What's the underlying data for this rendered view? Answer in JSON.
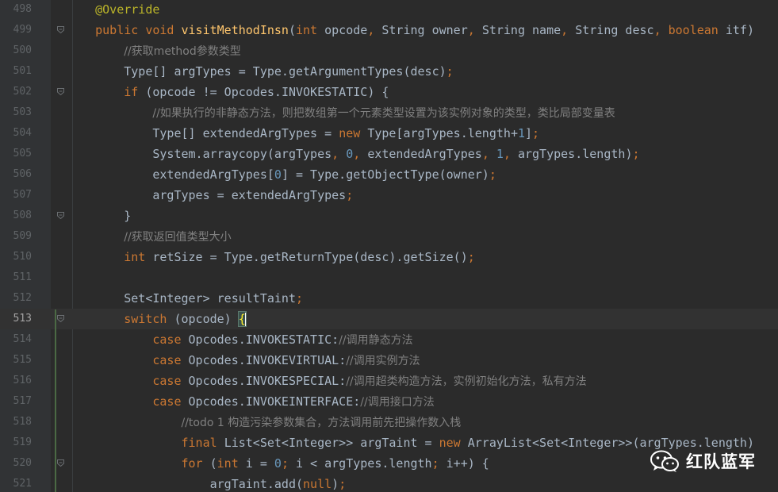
{
  "editor": {
    "lines": [
      {
        "no": "498",
        "fold": false,
        "indent": 1,
        "tokens": [
          {
            "t": "@Override",
            "c": "ann"
          }
        ]
      },
      {
        "no": "499",
        "fold": true,
        "indent": 1,
        "tokens": [
          {
            "t": "public ",
            "c": "kw"
          },
          {
            "t": "void ",
            "c": "kw"
          },
          {
            "t": "visitMethodInsn",
            "c": "fn"
          },
          {
            "t": "(",
            "c": "tx"
          },
          {
            "t": "int ",
            "c": "kw"
          },
          {
            "t": "opcode",
            "c": "tx"
          },
          {
            "t": ", ",
            "c": "kw"
          },
          {
            "t": "String owner",
            "c": "tx"
          },
          {
            "t": ", ",
            "c": "kw"
          },
          {
            "t": "String name",
            "c": "tx"
          },
          {
            "t": ", ",
            "c": "kw"
          },
          {
            "t": "String desc",
            "c": "tx"
          },
          {
            "t": ", ",
            "c": "kw"
          },
          {
            "t": "boolean ",
            "c": "kw"
          },
          {
            "t": "itf)",
            "c": "tx"
          }
        ]
      },
      {
        "no": "500",
        "fold": false,
        "indent": 2,
        "tokens": [
          {
            "t": "//获取method参数类型",
            "c": "cm"
          }
        ]
      },
      {
        "no": "501",
        "fold": false,
        "indent": 2,
        "tokens": [
          {
            "t": "Type[] argTypes = Type.",
            "c": "tx"
          },
          {
            "t": "getArgumentTypes",
            "c": "tx"
          },
          {
            "t": "(desc)",
            "c": "tx"
          },
          {
            "t": ";",
            "c": "kw"
          }
        ]
      },
      {
        "no": "502",
        "fold": true,
        "indent": 2,
        "tokens": [
          {
            "t": "if ",
            "c": "kw"
          },
          {
            "t": "(opcode != Opcodes.",
            "c": "tx"
          },
          {
            "t": "INVOKESTATIC",
            "c": "tx"
          },
          {
            "t": ") {",
            "c": "tx"
          }
        ]
      },
      {
        "no": "503",
        "fold": false,
        "indent": 3,
        "tokens": [
          {
            "t": "//如果执行的非静态方法，则把数组第一个元素类型设置为该实例对象的类型，类比局部变量表",
            "c": "cm"
          }
        ]
      },
      {
        "no": "504",
        "fold": false,
        "indent": 3,
        "tokens": [
          {
            "t": "Type[] extendedArgTypes = ",
            "c": "tx"
          },
          {
            "t": "new ",
            "c": "kw"
          },
          {
            "t": "Type[argTypes.",
            "c": "tx"
          },
          {
            "t": "length",
            "c": "tx"
          },
          {
            "t": "+",
            "c": "tx"
          },
          {
            "t": "1",
            "c": "num"
          },
          {
            "t": "]",
            "c": "tx"
          },
          {
            "t": ";",
            "c": "kw"
          }
        ]
      },
      {
        "no": "505",
        "fold": false,
        "indent": 3,
        "tokens": [
          {
            "t": "System.",
            "c": "tx"
          },
          {
            "t": "arraycopy",
            "c": "tx"
          },
          {
            "t": "(argTypes",
            "c": "tx"
          },
          {
            "t": ", ",
            "c": "kw"
          },
          {
            "t": "0",
            "c": "num"
          },
          {
            "t": ", ",
            "c": "kw"
          },
          {
            "t": "extendedArgTypes",
            "c": "tx"
          },
          {
            "t": ", ",
            "c": "kw"
          },
          {
            "t": "1",
            "c": "num"
          },
          {
            "t": ", ",
            "c": "kw"
          },
          {
            "t": "argTypes.",
            "c": "tx"
          },
          {
            "t": "length",
            "c": "tx"
          },
          {
            "t": ")",
            "c": "tx"
          },
          {
            "t": ";",
            "c": "kw"
          }
        ]
      },
      {
        "no": "506",
        "fold": false,
        "indent": 3,
        "tokens": [
          {
            "t": "extendedArgTypes[",
            "c": "tx"
          },
          {
            "t": "0",
            "c": "num"
          },
          {
            "t": "] = Type.",
            "c": "tx"
          },
          {
            "t": "getObjectType",
            "c": "tx"
          },
          {
            "t": "(owner)",
            "c": "tx"
          },
          {
            "t": ";",
            "c": "kw"
          }
        ]
      },
      {
        "no": "507",
        "fold": false,
        "indent": 3,
        "tokens": [
          {
            "t": "argTypes = extendedArgTypes",
            "c": "tx"
          },
          {
            "t": ";",
            "c": "kw"
          }
        ]
      },
      {
        "no": "508",
        "fold": true,
        "indent": 2,
        "tokens": [
          {
            "t": "}",
            "c": "tx"
          }
        ]
      },
      {
        "no": "509",
        "fold": false,
        "indent": 2,
        "tokens": [
          {
            "t": "//获取返回值类型大小",
            "c": "cm"
          }
        ]
      },
      {
        "no": "510",
        "fold": false,
        "indent": 2,
        "tokens": [
          {
            "t": "int ",
            "c": "kw"
          },
          {
            "t": "retSize = Type.",
            "c": "tx"
          },
          {
            "t": "getReturnType",
            "c": "tx"
          },
          {
            "t": "(desc).getSize()",
            "c": "tx"
          },
          {
            "t": ";",
            "c": "kw"
          }
        ]
      },
      {
        "no": "511",
        "fold": false,
        "indent": 0,
        "tokens": []
      },
      {
        "no": "512",
        "fold": false,
        "indent": 2,
        "tokens": [
          {
            "t": "Set<Integer> resultTaint",
            "c": "tx"
          },
          {
            "t": ";",
            "c": "kw"
          }
        ]
      },
      {
        "no": "513",
        "fold": true,
        "indent": 2,
        "current": true,
        "tokens": [
          {
            "t": "switch ",
            "c": "kw"
          },
          {
            "t": "(opcode) ",
            "c": "tx"
          },
          {
            "t": "{",
            "c": "brace"
          }
        ]
      },
      {
        "no": "514",
        "fold": false,
        "indent": 3,
        "tokens": [
          {
            "t": "case ",
            "c": "kw"
          },
          {
            "t": "Opcodes.",
            "c": "tx"
          },
          {
            "t": "INVOKESTATIC",
            "c": "tx"
          },
          {
            "t": ":",
            "c": "tx"
          },
          {
            "t": "//调用静态方法",
            "c": "cm"
          }
        ]
      },
      {
        "no": "515",
        "fold": false,
        "indent": 3,
        "tokens": [
          {
            "t": "case ",
            "c": "kw"
          },
          {
            "t": "Opcodes.",
            "c": "tx"
          },
          {
            "t": "INVOKEVIRTUAL",
            "c": "tx"
          },
          {
            "t": ":",
            "c": "tx"
          },
          {
            "t": "//调用实例方法",
            "c": "cm"
          }
        ]
      },
      {
        "no": "516",
        "fold": false,
        "indent": 3,
        "tokens": [
          {
            "t": "case ",
            "c": "kw"
          },
          {
            "t": "Opcodes.",
            "c": "tx"
          },
          {
            "t": "INVOKESPECIAL",
            "c": "tx"
          },
          {
            "t": ":",
            "c": "tx"
          },
          {
            "t": "//调用超类构造方法，实例初始化方法，私有方法",
            "c": "cm"
          }
        ]
      },
      {
        "no": "517",
        "fold": false,
        "indent": 3,
        "tokens": [
          {
            "t": "case ",
            "c": "kw"
          },
          {
            "t": "Opcodes.",
            "c": "tx"
          },
          {
            "t": "INVOKEINTERFACE",
            "c": "tx"
          },
          {
            "t": ":",
            "c": "tx"
          },
          {
            "t": "//调用接口方法",
            "c": "cm"
          }
        ]
      },
      {
        "no": "518",
        "fold": false,
        "indent": 4,
        "tokens": [
          {
            "t": "//todo 1 构造污染参数集合，方法调用前先把操作数入栈",
            "c": "cm"
          }
        ]
      },
      {
        "no": "519",
        "fold": false,
        "indent": 4,
        "tokens": [
          {
            "t": "final ",
            "c": "kw"
          },
          {
            "t": "List<Set<Integer>> argTaint = ",
            "c": "tx"
          },
          {
            "t": "new ",
            "c": "kw"
          },
          {
            "t": "ArrayList<Set<Integer>>(argTypes.",
            "c": "tx"
          },
          {
            "t": "length",
            "c": "tx"
          },
          {
            "t": ")",
            "c": "tx"
          }
        ]
      },
      {
        "no": "520",
        "fold": true,
        "indent": 4,
        "tokens": [
          {
            "t": "for ",
            "c": "kw"
          },
          {
            "t": "(",
            "c": "tx"
          },
          {
            "t": "int ",
            "c": "kw"
          },
          {
            "t": "i = ",
            "c": "tx"
          },
          {
            "t": "0",
            "c": "num"
          },
          {
            "t": "; ",
            "c": "kw"
          },
          {
            "t": "i < argTypes.",
            "c": "tx"
          },
          {
            "t": "length",
            "c": "tx"
          },
          {
            "t": "; ",
            "c": "kw"
          },
          {
            "t": "i++) {",
            "c": "tx"
          }
        ]
      },
      {
        "no": "521",
        "fold": false,
        "indent": 5,
        "tokens": [
          {
            "t": "argTaint.add(",
            "c": "tx"
          },
          {
            "t": "null",
            "c": "kw"
          },
          {
            "t": ")",
            "c": "tx"
          },
          {
            "t": ";",
            "c": "kw"
          }
        ]
      }
    ]
  },
  "watermark": {
    "icon": "wechat-icon",
    "text": "红队蓝军"
  },
  "colors": {
    "background": "#2b2b2b",
    "gutter": "#313335",
    "keyword": "#cc7832",
    "annotation": "#bbb529",
    "function": "#ffc66d",
    "number": "#6897bb",
    "comment": "#808080",
    "text": "#a9b7c6"
  }
}
